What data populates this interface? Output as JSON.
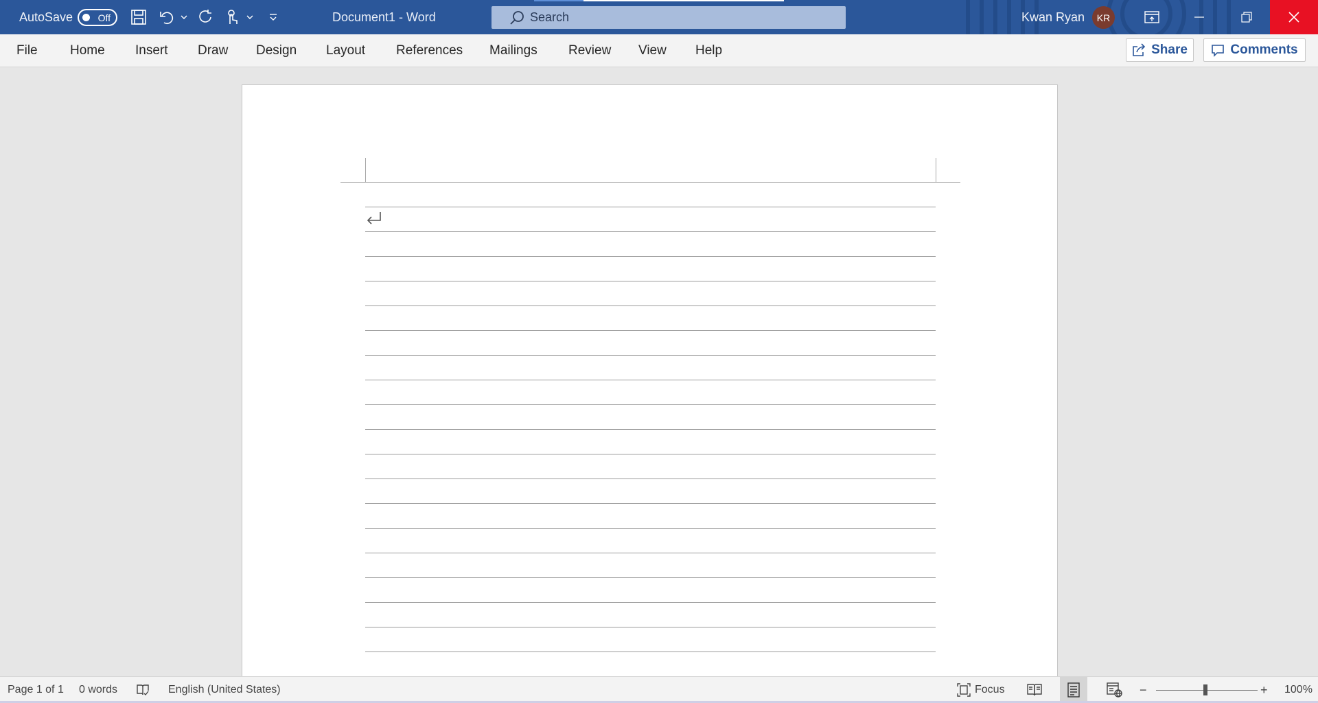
{
  "titlebar": {
    "autosave_label": "AutoSave",
    "autosave_state": "Off",
    "document_title": "Document1  -  Word",
    "search_placeholder": "Search",
    "user_name": "Kwan Ryan",
    "user_initials": "KR",
    "accent_color": "#2b579a",
    "close_color": "#e81123"
  },
  "ribbon": {
    "tabs": [
      "File",
      "Home",
      "Insert",
      "Draw",
      "Design",
      "Layout",
      "References",
      "Mailings",
      "Review",
      "View",
      "Help"
    ],
    "share_label": "Share",
    "comments_label": "Comments"
  },
  "status": {
    "page": "Page 1 of 1",
    "words": "0 words",
    "language": "English (United States)",
    "focus_label": "Focus",
    "zoom": "100%",
    "zoom_minus": "−",
    "zoom_plus": "+"
  },
  "icons": [
    "save-icon",
    "undo-icon",
    "redo-icon",
    "touch-mode-icon",
    "customize-icon",
    "search-icon",
    "ribbon-display-icon",
    "minimize-icon",
    "restore-icon",
    "close-icon",
    "share-icon",
    "comment-icon",
    "proofing-icon",
    "focus-icon",
    "read-mode-icon",
    "print-layout-icon",
    "web-layout-icon",
    "paragraph-mark-icon"
  ]
}
